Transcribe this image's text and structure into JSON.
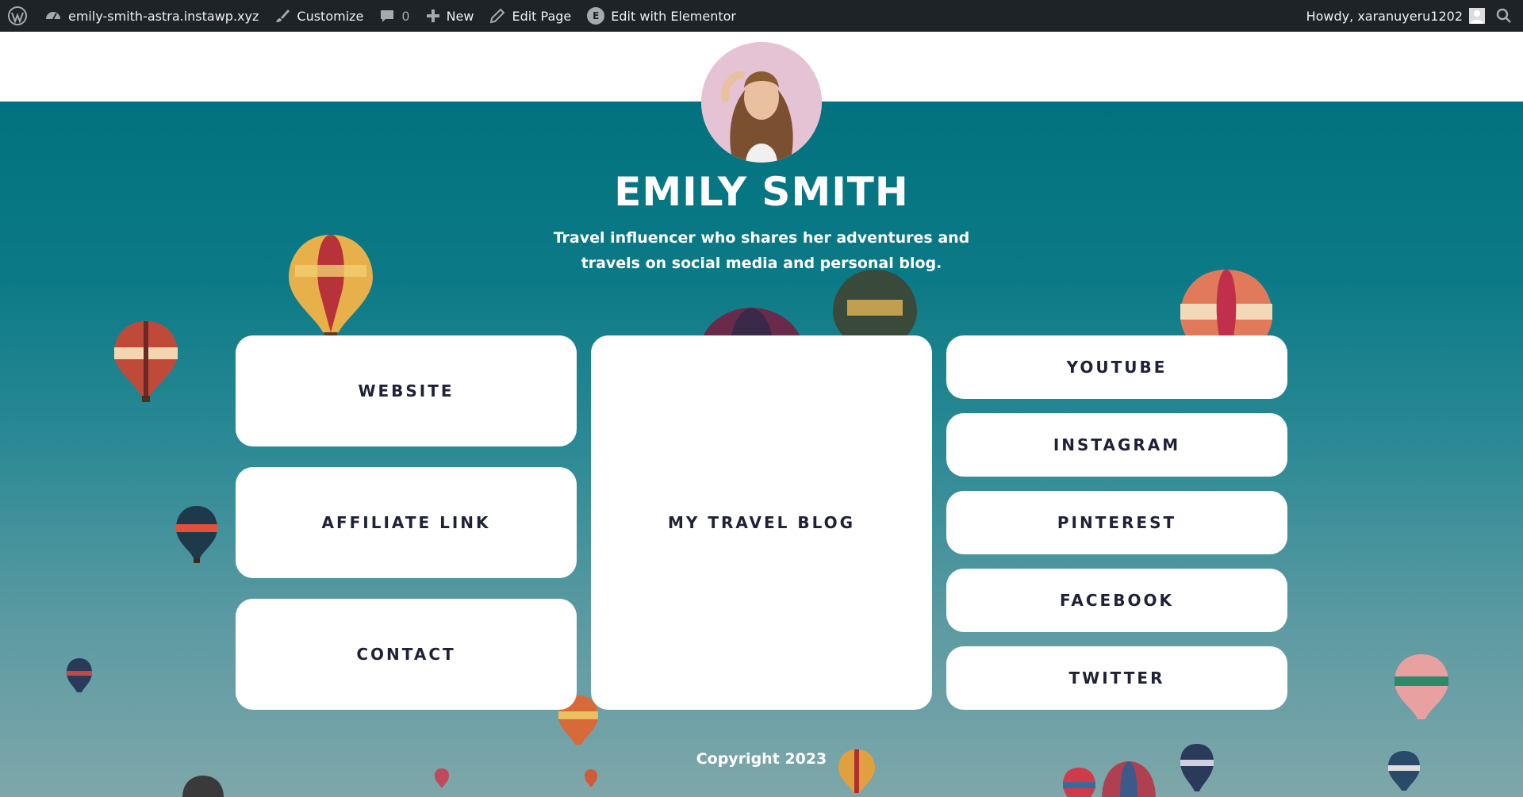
{
  "adminbar": {
    "site_name": "emily-smith-astra.instawp.xyz",
    "customize": "Customize",
    "comments_count": "0",
    "new": "New",
    "edit_page": "Edit Page",
    "edit_elementor": "Edit with Elementor",
    "elementor_badge": "E",
    "howdy": "Howdy, xaranuyeru1202"
  },
  "profile": {
    "name": "EMILY SMITH",
    "tagline": "Travel influencer who shares her adventures and travels on social media and personal blog."
  },
  "links": {
    "website": "WEBSITE",
    "affiliate": "AFFILIATE LINK",
    "contact": "CONTACT",
    "blog": "MY TRAVEL BLOG",
    "youtube": "YOUTUBE",
    "instagram": "INSTAGRAM",
    "pinterest": "PINTEREST",
    "facebook": "FACEBOOK",
    "twitter": "TWITTER"
  },
  "footer": {
    "copyright": "Copyright 2023"
  },
  "colors": {
    "adminbar": "#1d2327",
    "hero_top": "#02727f",
    "card_text": "#1f2237"
  }
}
